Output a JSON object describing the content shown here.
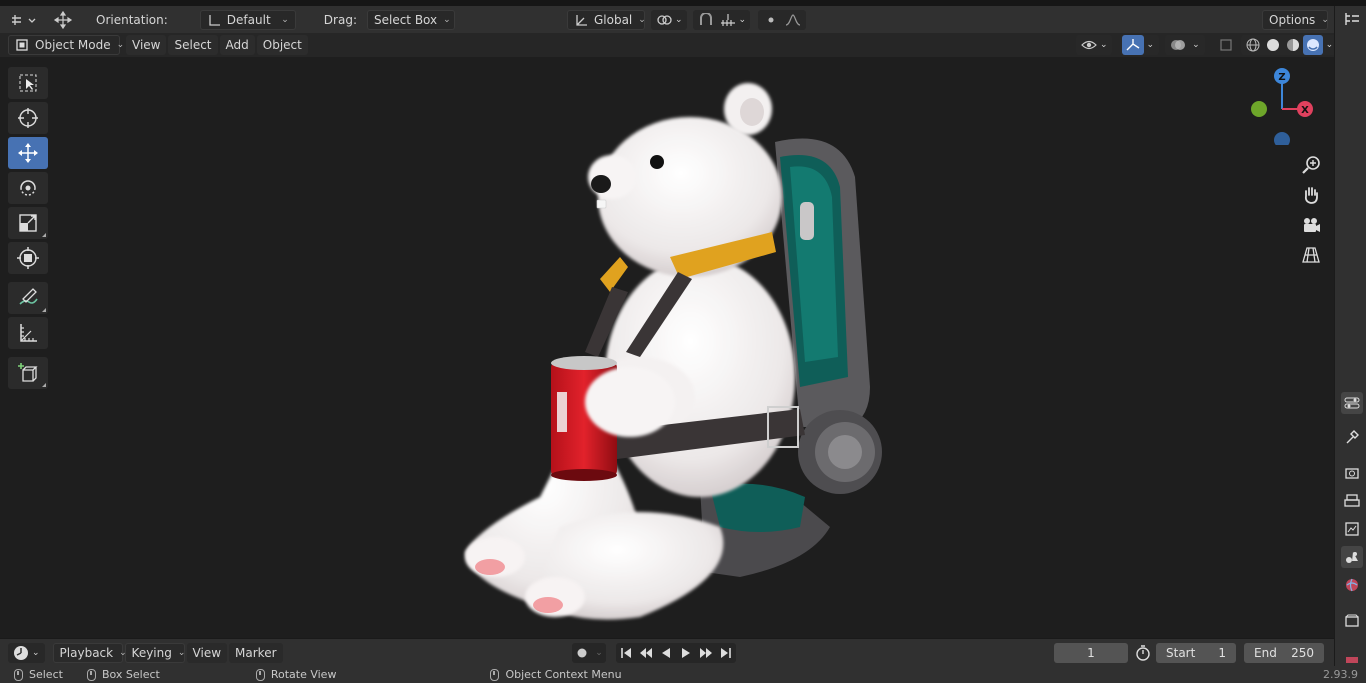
{
  "toolheader": {
    "orientation_label": "Orientation:",
    "orientation_value": "Default",
    "drag_label": "Drag:",
    "drag_value": "Select Box",
    "transform_orientation": "Global",
    "options_label": "Options"
  },
  "viewheader": {
    "mode": "Object Mode",
    "menus": [
      "View",
      "Select",
      "Add",
      "Object"
    ]
  },
  "gizmo": {
    "z": "Z",
    "x": "X"
  },
  "timeline": {
    "menus": [
      "Playback",
      "Keying",
      "View",
      "Marker"
    ],
    "current_frame": "1",
    "start_label": "Start",
    "start_value": "1",
    "end_label": "End",
    "end_value": "250"
  },
  "statusbar": {
    "select": "Select",
    "box_select": "Box Select",
    "rotate_view": "Rotate View",
    "context_menu": "Object Context Menu",
    "version": "2.93.9"
  },
  "colors": {
    "accent": "#4772b3",
    "axis_x": "#e0415e",
    "axis_y": "#6ea62a",
    "axis_z": "#3d86d9"
  }
}
